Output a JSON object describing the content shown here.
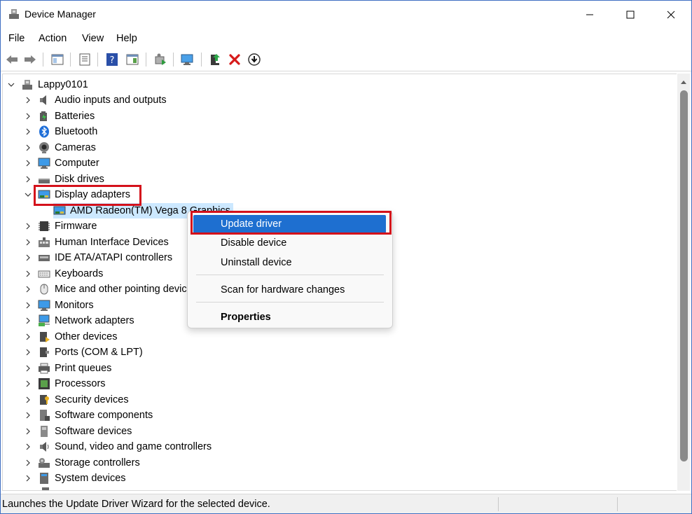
{
  "window": {
    "title": "Device Manager"
  },
  "menu": [
    "File",
    "Action",
    "View",
    "Help"
  ],
  "tree": {
    "root": "Lappy0101",
    "categories": [
      {
        "label": "Audio inputs and outputs",
        "icon": "speaker-icon"
      },
      {
        "label": "Batteries",
        "icon": "battery-icon"
      },
      {
        "label": "Bluetooth",
        "icon": "bluetooth-icon"
      },
      {
        "label": "Cameras",
        "icon": "camera-icon"
      },
      {
        "label": "Computer",
        "icon": "computer-icon"
      },
      {
        "label": "Disk drives",
        "icon": "disk-drive-icon"
      },
      {
        "label": "Display adapters",
        "icon": "display-adapter-icon",
        "expanded": true
      },
      {
        "label": "Firmware",
        "icon": "firmware-icon"
      },
      {
        "label": "Human Interface Devices",
        "icon": "hid-icon"
      },
      {
        "label": "IDE ATA/ATAPI controllers",
        "icon": "ide-controller-icon"
      },
      {
        "label": "Keyboards",
        "icon": "keyboard-icon"
      },
      {
        "label": "Mice and other pointing devices",
        "icon": "mouse-icon"
      },
      {
        "label": "Monitors",
        "icon": "monitor-icon"
      },
      {
        "label": "Network adapters",
        "icon": "network-adapter-icon"
      },
      {
        "label": "Other devices",
        "icon": "other-devices-icon"
      },
      {
        "label": "Ports (COM & LPT)",
        "icon": "port-icon"
      },
      {
        "label": "Print queues",
        "icon": "printer-icon"
      },
      {
        "label": "Processors",
        "icon": "processor-icon"
      },
      {
        "label": "Security devices",
        "icon": "security-device-icon"
      },
      {
        "label": "Software components",
        "icon": "software-component-icon"
      },
      {
        "label": "Software devices",
        "icon": "software-device-icon"
      },
      {
        "label": "Sound, video and game controllers",
        "icon": "sound-controller-icon"
      },
      {
        "label": "Storage controllers",
        "icon": "storage-controller-icon"
      },
      {
        "label": "System devices",
        "icon": "system-device-icon"
      }
    ],
    "child": {
      "label": "AMD Radeon(TM) Vega 8 Graphics",
      "icon": "display-adapter-icon"
    }
  },
  "context_menu": {
    "update": "Update driver",
    "disable": "Disable device",
    "uninstall": "Uninstall device",
    "scan": "Scan for hardware changes",
    "properties": "Properties"
  },
  "status": {
    "text": "Launches the Update Driver Wizard for the selected device."
  },
  "colors": {
    "highlight_border": "#d4111b",
    "menu_selected": "#1e6fd0",
    "selection": "#cce8ff"
  }
}
